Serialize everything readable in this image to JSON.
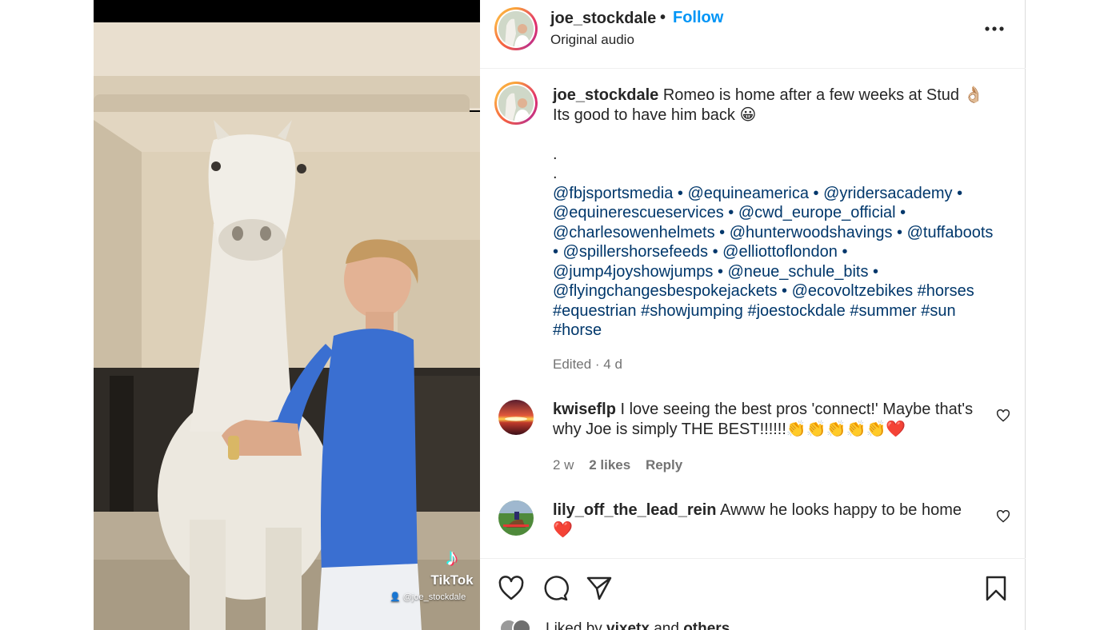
{
  "media": {
    "tiktok_word": "TikTok",
    "tiktok_handle": "@joe_stockdale",
    "tiktok_logo_icon": "tiktok-note-icon"
  },
  "header": {
    "username": "joe_stockdale",
    "separator": "•",
    "follow_label": "Follow",
    "audio": "Original audio",
    "more_icon": "more-horizontal-icon"
  },
  "caption": {
    "username": "joe_stockdale",
    "line1": " Romeo is home after a few weeks at Stud 👌🏼",
    "line2": "Its good to have him back 😀",
    "dot1": ".",
    "dot2": ".",
    "links": [
      "@fbjsportsmedia • @equineamerica • @yridersacademy •",
      "@equinerescueservices • @cwd_europe_official •",
      "@charlesowenhelmets • @hunterwoodshavings • @tuffaboots",
      "• @spillershorsefeeds • @elliottoflondon •",
      "@jump4joyshowjumps • @neue_schule_bits •",
      "@flyingchangesbespokejackets • @ecovoltzebikes #horses",
      "#equestrian #showjumping #joestockdale #summer #sun",
      "#horse"
    ],
    "edited": "Edited · 4 d"
  },
  "comments": [
    {
      "username": "kwiseflp",
      "line1": " I love seeing the best pros 'connect!' Maybe that's",
      "line2": "why Joe is simply THE BEST!!!!!!👏👏👏👏👏❤️",
      "age": "2 w",
      "likes": "2 likes",
      "reply": "Reply"
    },
    {
      "username": "lily_off_the_lead_rein",
      "line1": " Awww he looks happy to be home",
      "line2": "❤️"
    }
  ],
  "actions": {
    "like_icon": "heart-icon",
    "comment_icon": "comment-icon",
    "share_icon": "send-icon",
    "save_icon": "bookmark-icon"
  },
  "liked_by": {
    "prefix": "Liked by ",
    "user": "vixetx",
    "middle": " and ",
    "others": "others"
  }
}
